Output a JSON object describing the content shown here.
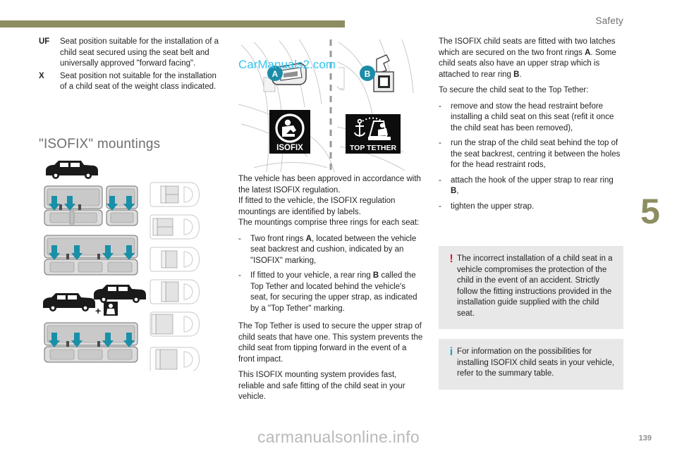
{
  "header": {
    "title": "Safety",
    "chapter_number": "5"
  },
  "footer": {
    "watermark": "carmanualsonline.info",
    "page_number": "139"
  },
  "definitions": [
    {
      "key": "UF",
      "text": "Seat position suitable for the installation of a child seat secured using the seat belt and universally approved \"forward facing\"."
    },
    {
      "key": "X",
      "text": "Seat position not suitable for the installation of a child seat of the weight class indicated."
    }
  ],
  "section": {
    "heading": "\"ISOFIX\" mountings"
  },
  "illustration": {
    "photo_watermark": "CarManuals2.com",
    "marker_a": "A",
    "marker_b": "B",
    "label_isofix": "ISOFIX",
    "label_top_tether": "TOP TETHER",
    "plus_sign": "+"
  },
  "middle_column": {
    "paragraph_1": "The vehicle has been approved in accordance with the latest ISOFIX regulation.",
    "paragraph_2": "If fitted to the vehicle, the ISOFIX regulation mountings are identified by labels.",
    "paragraph_3": "The mountings comprise three rings for each seat:",
    "bullets": [
      {
        "pre": "Two front rings ",
        "bold": "A",
        "post": ", located between the vehicle seat backrest and cushion, indicated by an \"ISOFIX\" marking,"
      },
      {
        "pre": "If fitted to your vehicle, a rear ring ",
        "bold": "B",
        "post": " called the Top Tether and located behind the vehicle's seat, for securing the upper strap, as indicated by a \"Top Tether\" marking."
      }
    ],
    "paragraph_4": "The Top Tether is used to secure the upper strap of child seats that have one. This system prevents the child seat from tipping forward in the event of a front impact.",
    "paragraph_5": "This ISOFIX mounting system provides fast, reliable and safe fitting of the child seat in your vehicle."
  },
  "right_column": {
    "paragraph_1_pre": "The ISOFIX child seats are fitted with two latches which are secured on the two front rings ",
    "paragraph_1_bold": "A",
    "paragraph_1_post": ".",
    "paragraph_2_pre": "Some child seats also have an upper strap which is attached to rear ring ",
    "paragraph_2_bold": "B",
    "paragraph_2_post": ".",
    "intro": "To secure the child seat to the Top Tether:",
    "bullets": [
      {
        "pre": "remove and stow the head restraint before installing a child seat on this seat (refit it once the child seat has been removed),",
        "bold": "",
        "post": ""
      },
      {
        "pre": "run the strap of the child seat behind the top of the seat backrest, centring it between the holes for the head restraint rods,",
        "bold": "",
        "post": ""
      },
      {
        "pre": "attach the hook of the upper strap to rear ring ",
        "bold": "B",
        "post": ","
      },
      {
        "pre": "tighten the upper strap.",
        "bold": "",
        "post": ""
      }
    ],
    "callouts": [
      {
        "kind": "warning",
        "glyph": "!",
        "text": "The incorrect installation of a child seat in a vehicle compromises the protection of the child in the event of an accident. Strictly follow the fitting instructions provided in the installation guide supplied with the child seat."
      },
      {
        "kind": "info",
        "glyph": "i",
        "text": "For information on the possibilities for installing ISOFIX child seats in your vehicle, refer to the summary table."
      }
    ]
  },
  "colors": {
    "accent_olive": "#8d8d62",
    "marker_teal": "#1b8ca8",
    "arrow_teal": "#1a8fa8",
    "warning_red": "#e8112d",
    "info_blue": "#1b9dd9",
    "callout_bg": "#e8e8e8",
    "watermark_cyan": "#35c6ef"
  }
}
